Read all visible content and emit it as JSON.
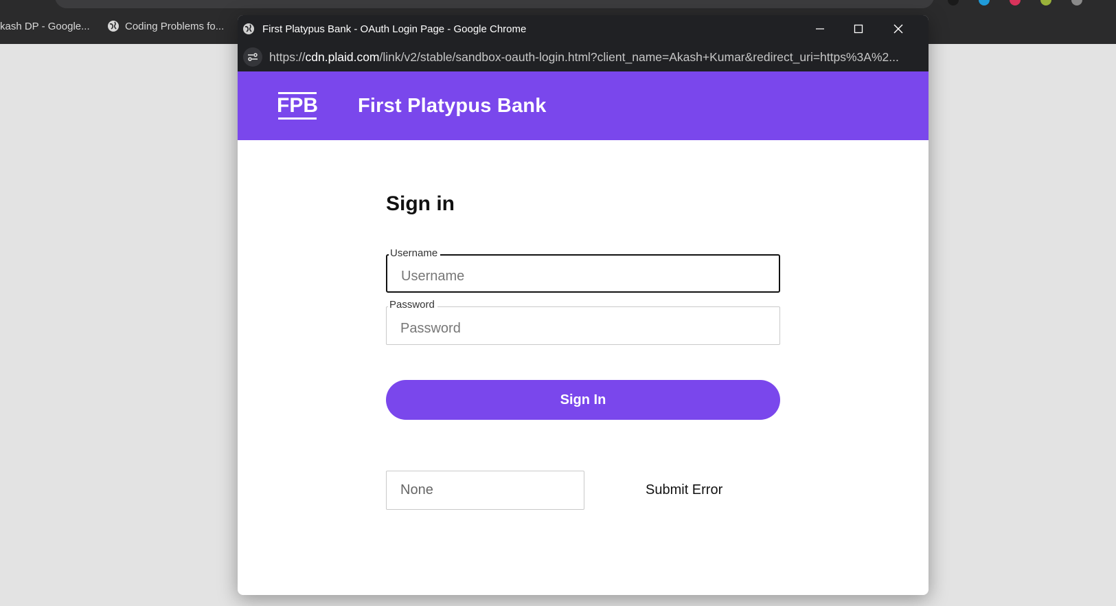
{
  "background": {
    "bookmarks": [
      {
        "label": "kash DP - Google...",
        "icon": "none"
      },
      {
        "label": "Coding Problems fo...",
        "icon": "globe-icon"
      }
    ]
  },
  "popup": {
    "window_title": "First Platypus Bank - OAuth Login Page - Google Chrome",
    "url_prefix": "https://",
    "url_host": "cdn.plaid.com",
    "url_path": "/link/v2/stable/sandbox-oauth-login.html?client_name=Akash+Kumar&redirect_uri=https%3A%2..."
  },
  "bank": {
    "logo_text": "FPB",
    "name": "First Platypus Bank",
    "brand_color": "#7a47ec"
  },
  "form": {
    "title": "Sign in",
    "username_label": "Username",
    "username_placeholder": "Username",
    "username_value": "",
    "password_label": "Password",
    "password_placeholder": "Password",
    "password_value": "",
    "signin_button": "Sign In",
    "error_select_value": "None",
    "submit_error_label": "Submit Error"
  }
}
